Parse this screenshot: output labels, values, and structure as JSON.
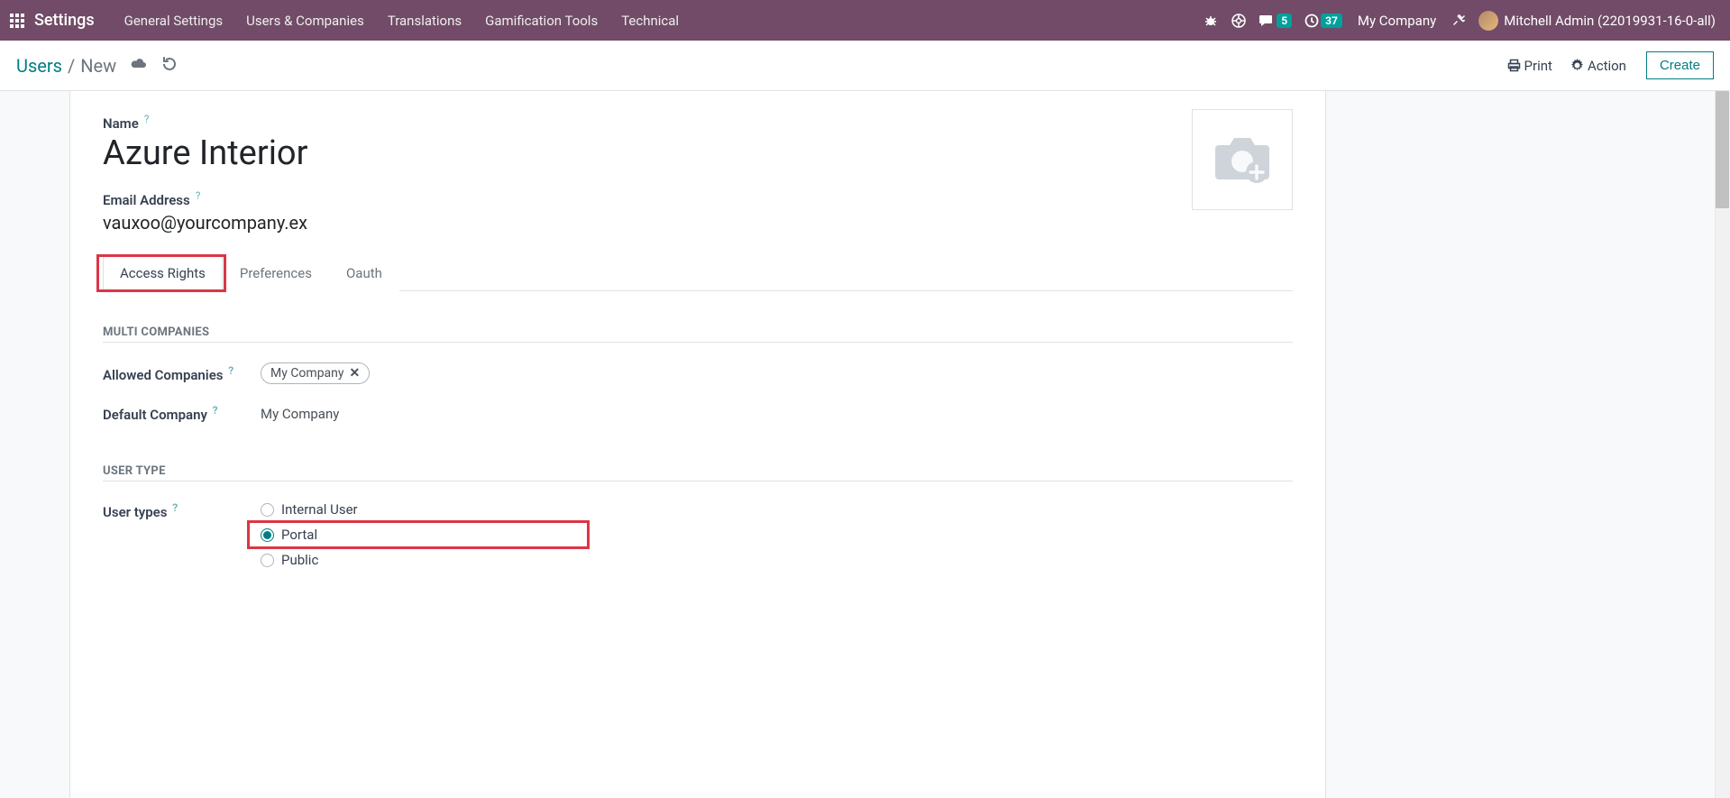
{
  "navbar": {
    "app_title": "Settings",
    "menus": [
      "General Settings",
      "Users & Companies",
      "Translations",
      "Gamification Tools",
      "Technical"
    ],
    "messages_count": "5",
    "activities_count": "37",
    "company": "My Company",
    "user_name": "Mitchell Admin (22019931-16-0-all)"
  },
  "breadcrumb": {
    "root": "Users",
    "current": "New"
  },
  "actions": {
    "print": "Print",
    "action": "Action",
    "create": "Create"
  },
  "form": {
    "name_label": "Name",
    "name_value": "Azure Interior",
    "email_label": "Email Address",
    "email_value": "vauxoo@yourcompany.ex",
    "tabs": {
      "access": "Access Rights",
      "prefs": "Preferences",
      "oauth": "Oauth"
    },
    "sections": {
      "multi_companies": "MULTI COMPANIES",
      "user_type": "USER TYPE"
    },
    "fields": {
      "allowed_companies_label": "Allowed Companies",
      "allowed_companies_tag": "My Company",
      "default_company_label": "Default Company",
      "default_company_value": "My Company",
      "user_types_label": "User types",
      "user_types_options": {
        "internal": "Internal User",
        "portal": "Portal",
        "public": "Public"
      }
    }
  }
}
